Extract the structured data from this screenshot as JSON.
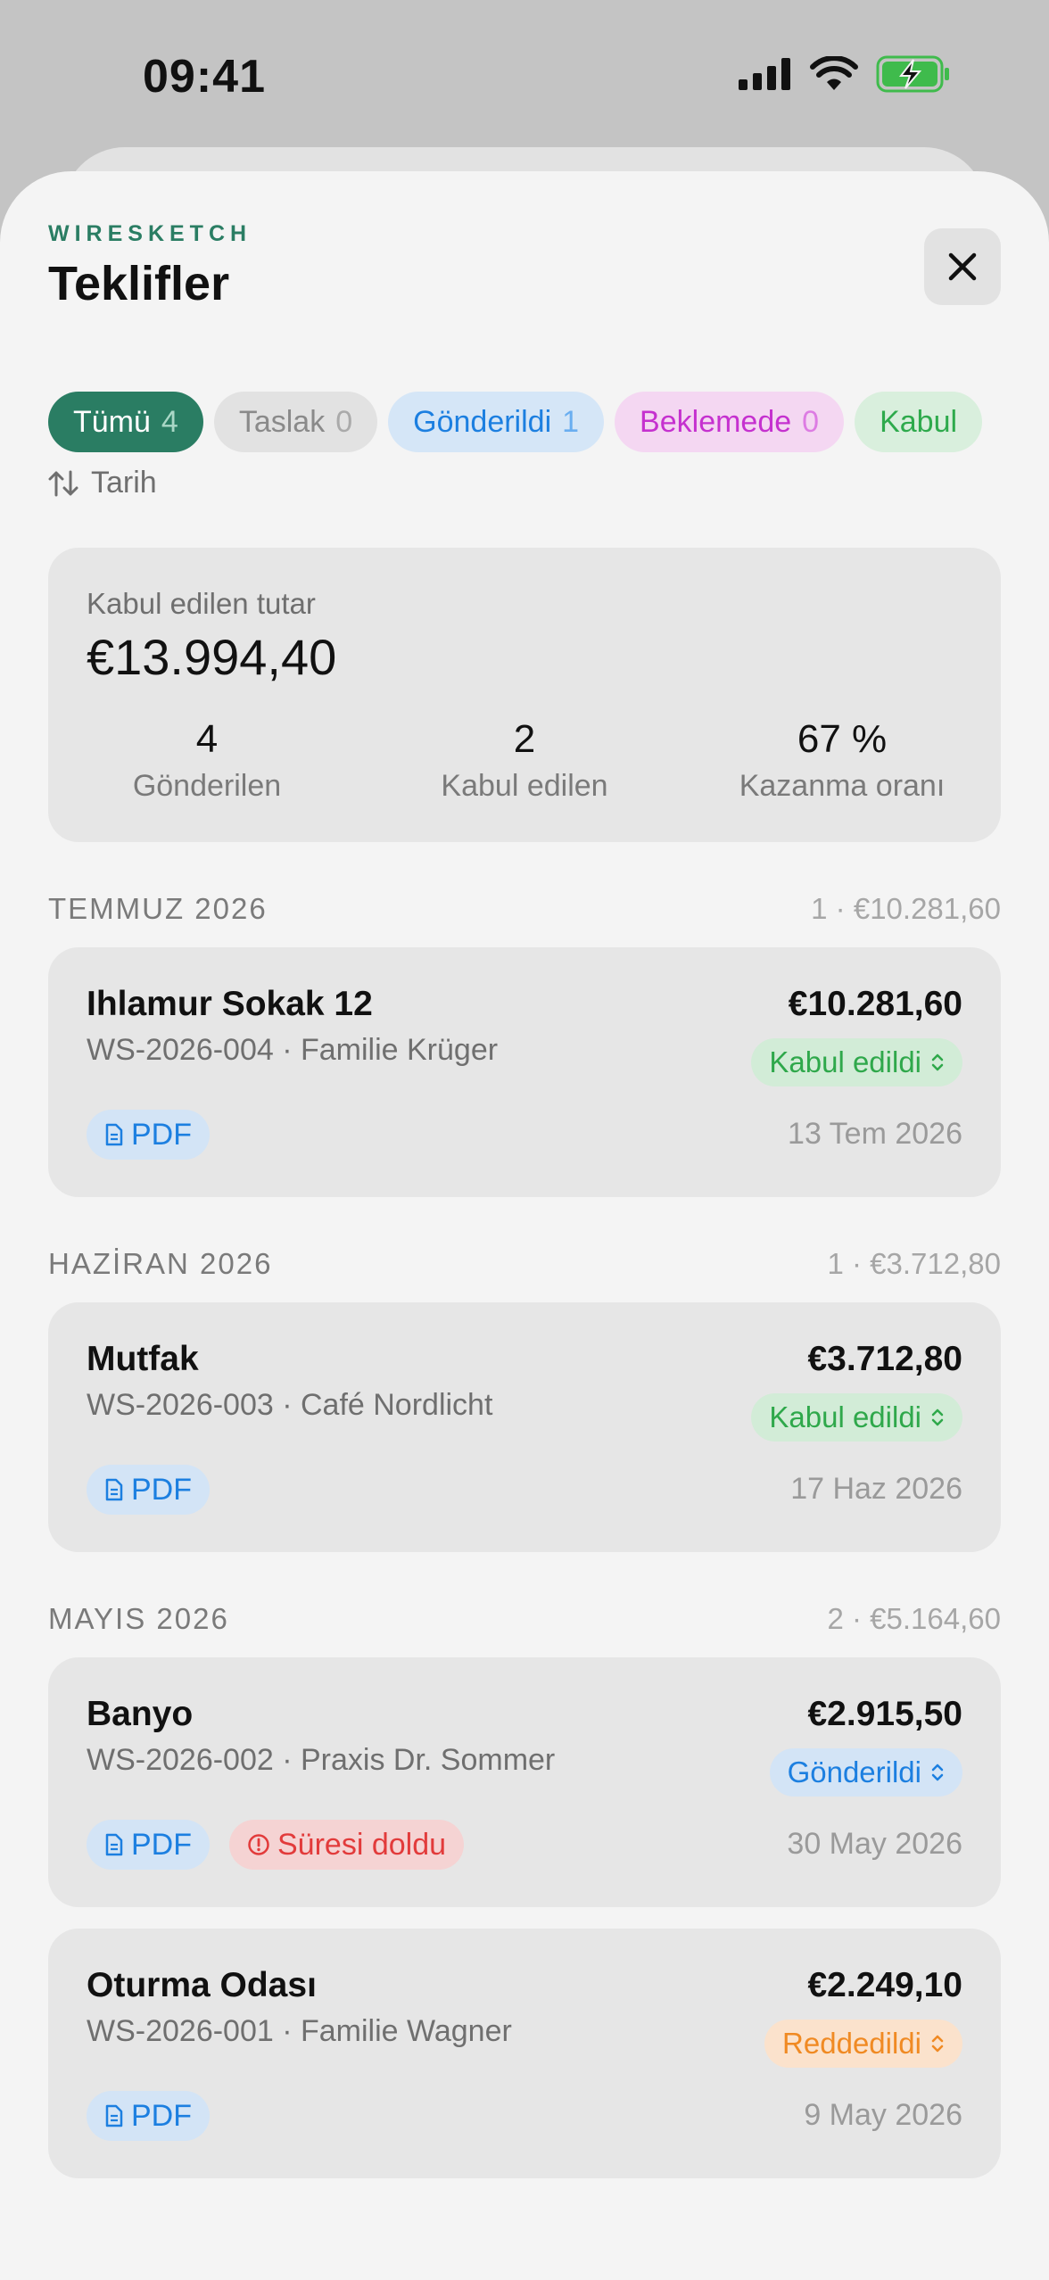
{
  "status_bar": {
    "time": "09:41"
  },
  "header": {
    "brand": "WIRESKETCH",
    "title": "Teklifler"
  },
  "filters": [
    {
      "label": "Tümü",
      "count": "4"
    },
    {
      "label": "Taslak",
      "count": "0"
    },
    {
      "label": "Gönderildi",
      "count": "1"
    },
    {
      "label": "Beklemede",
      "count": "0"
    },
    {
      "label": "Kabul",
      "count": ""
    }
  ],
  "sort": {
    "label": "Tarih"
  },
  "summary": {
    "label": "Kabul edilen tutar",
    "amount": "€13.994,40",
    "stats": [
      {
        "value": "4",
        "label": "Gönderilen"
      },
      {
        "value": "2",
        "label": "Kabul edilen"
      },
      {
        "value": "67 %",
        "label": "Kazanma oranı"
      }
    ]
  },
  "sections": [
    {
      "title": "TEMMUZ 2026",
      "sum": "1 · €10.281,60",
      "quotes": [
        {
          "title": "Ihlamur Sokak 12",
          "sub": "WS-2026-004 · Familie Krüger",
          "amount": "€10.281,60",
          "status": "Kabul edildi",
          "date": "13 Tem 2026",
          "pdf": "PDF",
          "expired": ""
        }
      ]
    },
    {
      "title": "HAZİRAN 2026",
      "sum": "1 · €3.712,80",
      "quotes": [
        {
          "title": "Mutfak",
          "sub": "WS-2026-003 · Café Nordlicht",
          "amount": "€3.712,80",
          "status": "Kabul edildi",
          "date": "17 Haz 2026",
          "pdf": "PDF",
          "expired": ""
        }
      ]
    },
    {
      "title": "MAYIS 2026",
      "sum": "2 · €5.164,60",
      "quotes": [
        {
          "title": "Banyo",
          "sub": "WS-2026-002 · Praxis Dr. Sommer",
          "amount": "€2.915,50",
          "status": "Gönderildi",
          "date": "30 May 2026",
          "pdf": "PDF",
          "expired": "Süresi doldu"
        },
        {
          "title": "Oturma Odası",
          "sub": "WS-2026-001 · Familie Wagner",
          "amount": "€2.249,10",
          "status": "Reddedildi",
          "date": "9 May 2026",
          "pdf": "PDF",
          "expired": ""
        }
      ]
    }
  ],
  "colors": {
    "accent": "#2a7d63",
    "sent": "#1c7fe0",
    "accepted": "#2fa84b",
    "pending": "#c531cf",
    "rejected": "#f08a23",
    "expired": "#e23b3b"
  },
  "icons": [
    "signal-icon",
    "wifi-icon",
    "battery-charging-icon",
    "close-icon",
    "sort-icon",
    "document-icon",
    "chevron-updown-icon",
    "alert-circle-icon"
  ]
}
